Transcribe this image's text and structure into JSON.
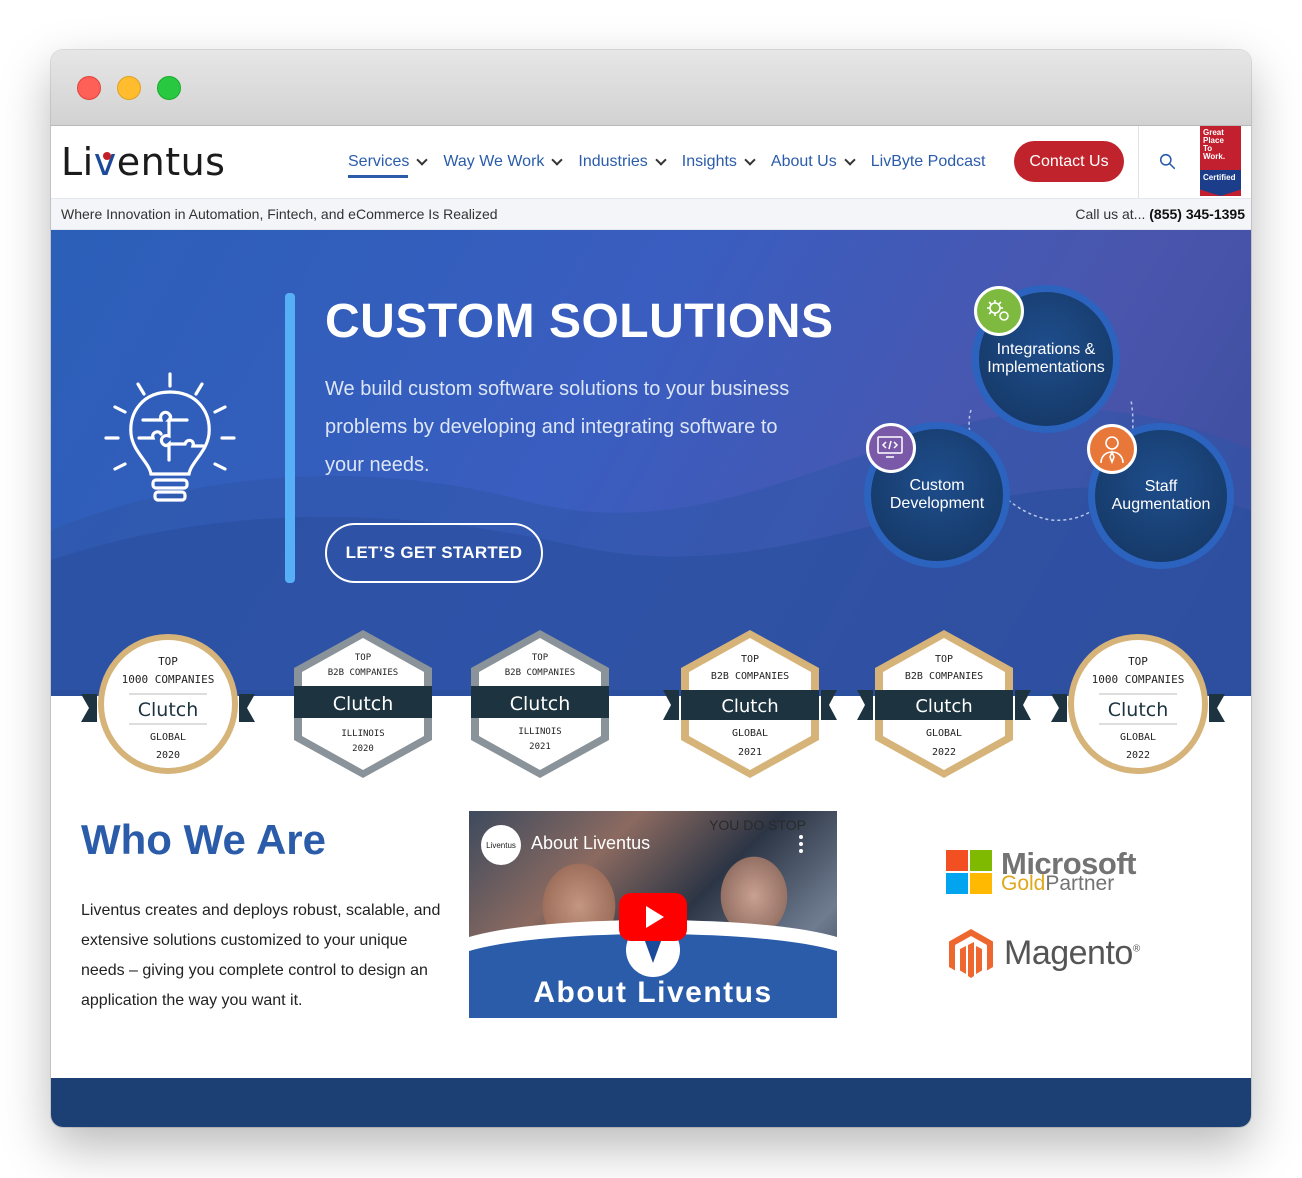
{
  "window": {
    "controls": [
      "close",
      "minimize",
      "maximize"
    ]
  },
  "header": {
    "logo": {
      "part1": "Li",
      "part2": "v",
      "part3": "entus"
    },
    "nav": [
      {
        "label": "Services",
        "dropdown": true,
        "active": true
      },
      {
        "label": "Way We Work",
        "dropdown": true
      },
      {
        "label": "Industries",
        "dropdown": true
      },
      {
        "label": "Insights",
        "dropdown": true
      },
      {
        "label": "About Us",
        "dropdown": true
      },
      {
        "label": "LivByte Podcast",
        "dropdown": false
      }
    ],
    "contact_label": "Contact Us",
    "search_icon": "search-icon",
    "gptw": {
      "line1": "Great",
      "line2": "Place",
      "line3": "To",
      "line4": "Work.",
      "cert": "Certified"
    }
  },
  "infobar": {
    "tagline": "Where Innovation in Automation, Fintech, and eCommerce Is Realized",
    "call_prefix": "Call us at...",
    "phone": "(855) 345-1395"
  },
  "hero": {
    "title": "CUSTOM SOLUTIONS",
    "text": "We build custom software solutions to your business problems by developing and integrating software to your needs.",
    "cta": "LET’S GET STARTED",
    "icon": "lightbulb-puzzle-icon",
    "services": [
      {
        "label": "Integrations & Implementations",
        "icon": "gears-icon",
        "icon_color": "#7dba3f"
      },
      {
        "label": "Custom Development",
        "icon": "code-monitor-icon",
        "icon_color": "#7a5aa8"
      },
      {
        "label": "Staff Augmentation",
        "icon": "person-icon",
        "icon_color": "#e8773a"
      }
    ]
  },
  "badges": [
    {
      "top": "TOP",
      "line": "1000 COMPANIES",
      "brand": "Clutch",
      "region": "GLOBAL",
      "year": "2020",
      "shape": "circle"
    },
    {
      "top": "TOP",
      "line": "B2B COMPANIES",
      "brand": "Clutch",
      "region": "ILLINOIS",
      "year": "2020",
      "shape": "hex-silver"
    },
    {
      "top": "TOP",
      "line": "B2B COMPANIES",
      "brand": "Clutch",
      "region": "ILLINOIS",
      "year": "2021",
      "shape": "hex-silver"
    },
    {
      "top": "TOP",
      "line": "B2B COMPANIES",
      "brand": "Clutch",
      "region": "GLOBAL",
      "year": "2021",
      "shape": "hex-gold"
    },
    {
      "top": "TOP",
      "line": "B2B COMPANIES",
      "brand": "Clutch",
      "region": "GLOBAL",
      "year": "2022",
      "shape": "hex-gold"
    },
    {
      "top": "TOP",
      "line": "1000 COMPANIES",
      "brand": "Clutch",
      "region": "GLOBAL",
      "year": "2022",
      "shape": "circle"
    }
  ],
  "who": {
    "title": "Who We Are",
    "text": "Liventus creates and deploys robust, scalable, and extensive solutions customized to your unique needs – giving you complete control to design an application the way you want it."
  },
  "video": {
    "title": "About Liventus",
    "channel_logo": "Liventus",
    "banner": "About Liventus",
    "wall_text": "YOU DO STOP"
  },
  "partners": {
    "microsoft": {
      "name": "Microsoft",
      "gold": "Gold",
      "partner": "Partner"
    },
    "magento": {
      "name": "Magento",
      "reg": "®"
    }
  },
  "colors": {
    "brand_blue": "#2a5caa",
    "contact_red": "#c0232b",
    "footer": "#1c3f74",
    "ms_red": "#f25022",
    "ms_green": "#7fba00",
    "ms_blue": "#00a4ef",
    "ms_yellow": "#ffb900",
    "magento_orange": "#ee672f"
  }
}
